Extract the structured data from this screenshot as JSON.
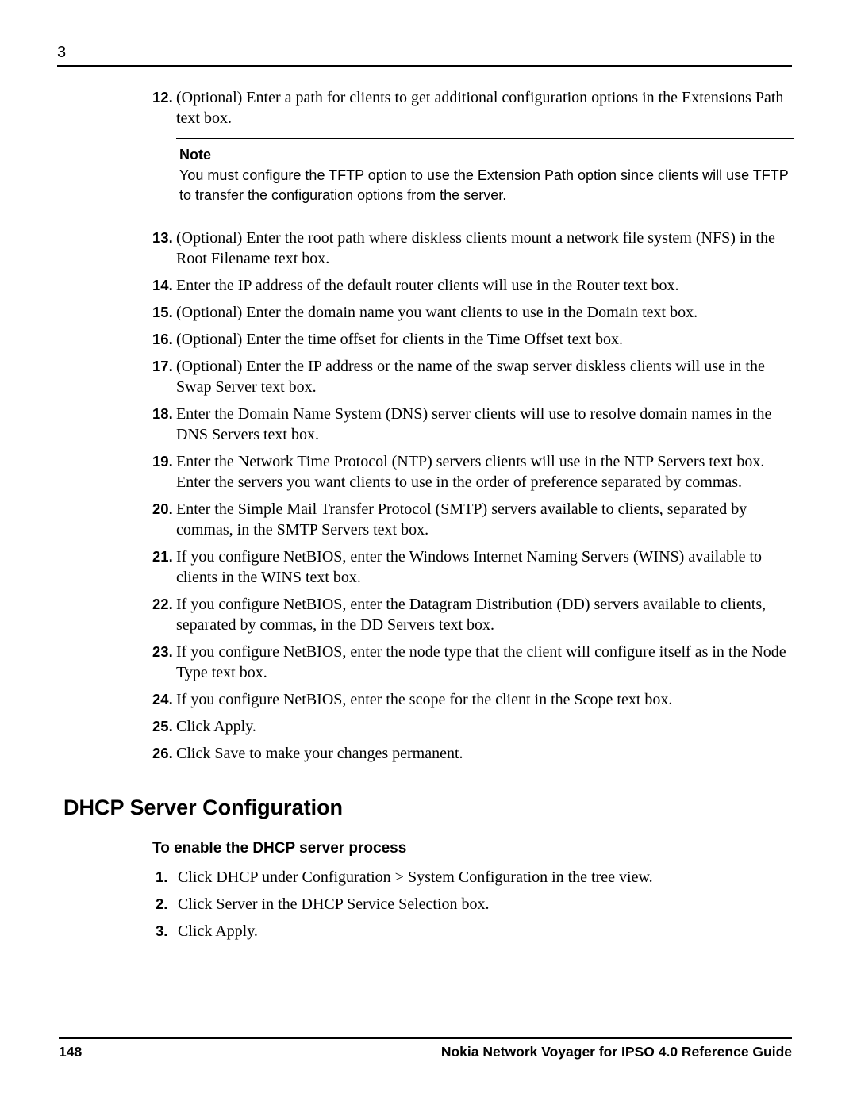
{
  "chapter_number": "3",
  "steps_top": [
    {
      "num": "12.",
      "text": "(Optional) Enter a path for clients to get additional configuration options in the Extensions Path text box."
    }
  ],
  "note": {
    "heading": "Note",
    "text": "You must configure the TFTP option to use the Extension Path option since clients will use TFTP to transfer the configuration options from the server."
  },
  "steps_mid": [
    {
      "num": "13.",
      "text": "(Optional) Enter the root path where diskless clients mount a network file system (NFS) in the Root Filename text box."
    },
    {
      "num": "14.",
      "text": "Enter the IP address of the default router clients will use in the Router text box."
    },
    {
      "num": "15.",
      "text": "(Optional) Enter the domain name you want clients to use in the Domain text box."
    },
    {
      "num": "16.",
      "text": "(Optional) Enter the time offset for clients in the Time Offset text box."
    },
    {
      "num": "17.",
      "text": "(Optional) Enter the IP address or the name of the swap server diskless clients will use in the Swap Server text box."
    },
    {
      "num": "18.",
      "text": "Enter the Domain Name System (DNS) server clients will use to resolve domain names in the DNS Servers text box."
    },
    {
      "num": "19.",
      "text": "Enter the Network Time Protocol (NTP) servers clients will use in the NTP Servers text box. Enter the servers you want clients to use in the order of preference separated by commas."
    },
    {
      "num": "20.",
      "text": "Enter the Simple Mail Transfer Protocol (SMTP) servers available to clients, separated by commas, in the SMTP Servers text box."
    },
    {
      "num": "21.",
      "text": "If you configure NetBIOS, enter the Windows Internet Naming Servers (WINS) available to clients in the WINS text box."
    },
    {
      "num": "22.",
      "text": "If you configure NetBIOS, enter the Datagram Distribution (DD) servers available to clients, separated by commas, in the DD Servers text box."
    },
    {
      "num": "23.",
      "text": "If you configure NetBIOS, enter the node type that the client will configure itself as in the Node Type text box."
    },
    {
      "num": "24.",
      "text": "If you configure NetBIOS, enter the scope for the client in the Scope text box."
    },
    {
      "num": "25.",
      "text": "Click Apply."
    },
    {
      "num": "26.",
      "text": "Click Save to make your changes permanent."
    }
  ],
  "section_title": "DHCP Server Configuration",
  "sub_heading": "To enable the DHCP server process",
  "sub_steps": [
    {
      "num": "1.",
      "text": "Click DHCP under Configuration > System Configuration in the tree view."
    },
    {
      "num": "2.",
      "text": "Click Server in the DHCP Service Selection box."
    },
    {
      "num": "3.",
      "text": "Click Apply."
    }
  ],
  "footer": {
    "page_number": "148",
    "title": "Nokia Network Voyager for IPSO 4.0 Reference Guide"
  }
}
